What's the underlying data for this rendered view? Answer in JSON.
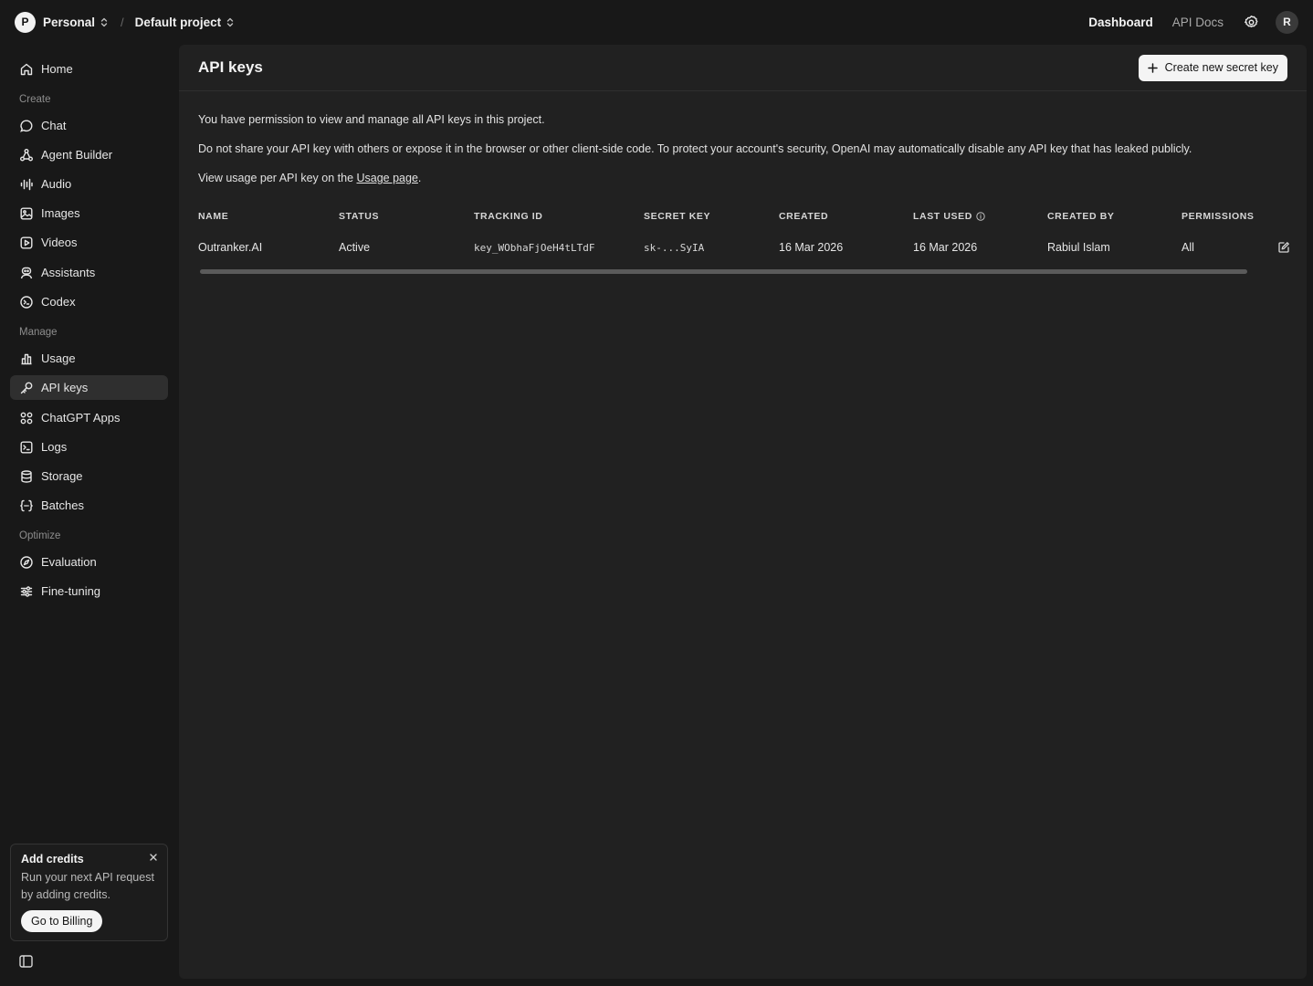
{
  "topbar": {
    "org_initial": "P",
    "org_name": "Personal",
    "separator": "/",
    "project_name": "Default project",
    "links": [
      {
        "label": "Dashboard",
        "active": true
      },
      {
        "label": "API Docs",
        "active": false
      }
    ],
    "user_initial": "R"
  },
  "sidebar": {
    "home": "Home",
    "sections": {
      "create": "Create",
      "manage": "Manage",
      "optimize": "Optimize"
    },
    "create_items": [
      "Chat",
      "Agent Builder",
      "Audio",
      "Images",
      "Videos",
      "Assistants",
      "Codex"
    ],
    "manage_items": [
      "Usage",
      "API keys",
      "ChatGPT Apps",
      "Logs",
      "Storage",
      "Batches"
    ],
    "optimize_items": [
      "Evaluation",
      "Fine-tuning"
    ],
    "active_item": "API keys",
    "credits": {
      "title": "Add credits",
      "text_line1": "Run your next API request",
      "text_line2": "by adding credits.",
      "button": "Go to Billing"
    }
  },
  "main": {
    "title": "API keys",
    "create_button": "Create new secret key",
    "permission_text": "You have permission to view and manage all API keys in this project.",
    "warning_text": "Do not share your API key with others or expose it in the browser or other client-side code. To protect your account's security, OpenAI may automatically disable any API key that has leaked publicly.",
    "usage_prefix": "View usage per API key on the ",
    "usage_link": "Usage page",
    "usage_suffix": ".",
    "table": {
      "headers": [
        "NAME",
        "STATUS",
        "TRACKING ID",
        "SECRET KEY",
        "CREATED",
        "LAST USED",
        "CREATED BY",
        "PERMISSIONS"
      ],
      "rows": [
        {
          "name": "Outranker.AI",
          "status": "Active",
          "tracking_id": "key_WObhaFjOeH4tLTdF",
          "secret_key": "sk-...SyIA",
          "created": "16 Mar 2026",
          "last_used": "16 Mar 2026",
          "created_by": "Rabiul Islam",
          "permissions": "All"
        }
      ]
    }
  },
  "icons": {
    "org": "avatar",
    "updown": "chevron-up-down-icon",
    "settings": "gear-icon",
    "home": "home-icon",
    "chat": "chat-bubble-icon",
    "agent": "agent-flow-icon",
    "audio": "waveform-icon",
    "images": "image-icon",
    "videos": "play-icon",
    "assistants": "assistant-icon",
    "codex": "terminal-icon",
    "usage": "bar-chart-icon",
    "apikeys": "key-icon",
    "apps": "apps-grid-icon",
    "logs": "logs-icon",
    "storage": "database-icon",
    "batches": "braces-icon",
    "evaluation": "compass-icon",
    "finetuning": "sliders-icon",
    "edit": "edit-icon",
    "info": "info-icon",
    "close": "close-icon",
    "plus": "plus-icon",
    "sidebar_toggle": "sidebar-toggle-icon"
  }
}
